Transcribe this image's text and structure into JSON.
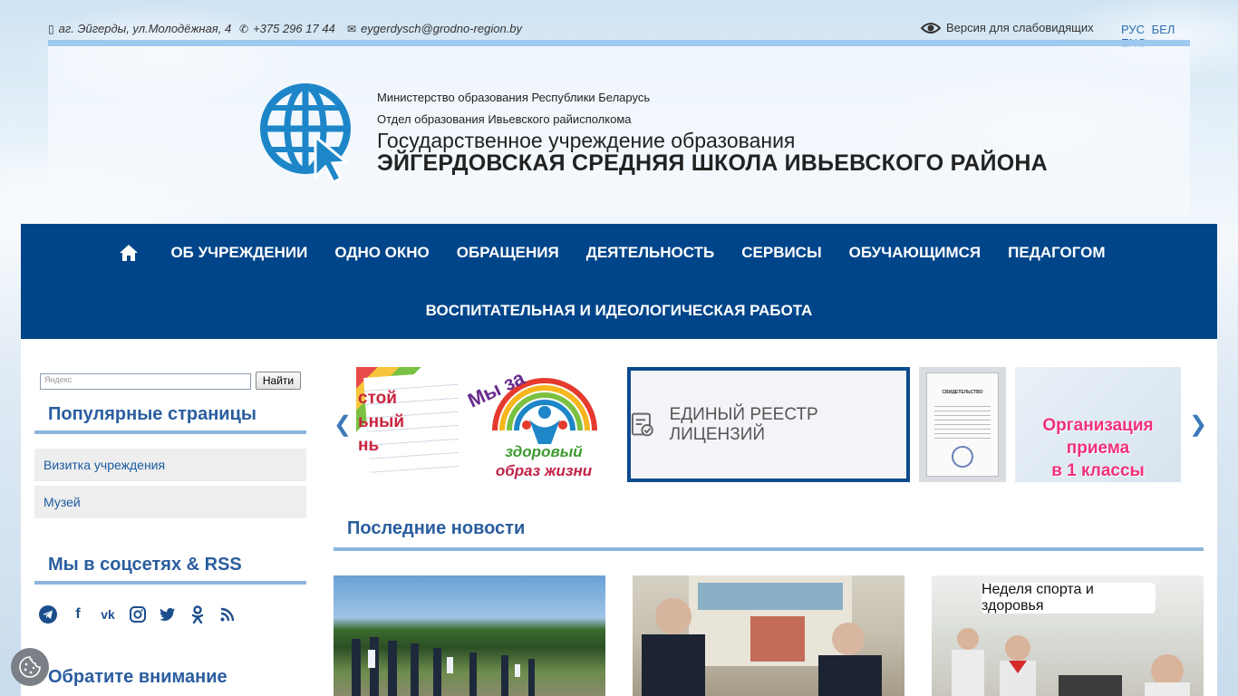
{
  "topbar": {
    "address": "аг. Эйгерды, ул.Молодёжная, 4",
    "phone": "+375 296 17 44",
    "email": "eygerdysch@grodno-region.by",
    "low_vision": "Версия для слабовидящих",
    "languages": [
      "РУС",
      "БЕЛ",
      "ENG"
    ]
  },
  "header": {
    "ministry": "Министерство образования Республики Беларусь",
    "department": "Отдел образования Ивьевского райисполкома",
    "institution_type": "Государственное учреждение образования",
    "school_name": "ЭЙГЕРДОВСКАЯ СРЕДНЯЯ ШКОЛА ИВЬЕВСКОГО РАЙОНА"
  },
  "nav": {
    "items": [
      "ОБ УЧРЕЖДЕНИИ",
      "ОДНО ОКНО",
      "ОБРАЩЕНИЯ",
      "ДЕЯТЕЛЬНОСТЬ",
      "СЕРВИСЫ",
      "ОБУЧАЮЩИМСЯ",
      "ПЕДАГОГОМ"
    ],
    "second_row": "ВОСПИТАТЕЛЬНАЯ И ИДЕОЛОГИЧЕСКАЯ РАБОТА"
  },
  "search": {
    "placeholder": "Яндекс",
    "button": "Найти"
  },
  "sidebar": {
    "popular_title": "Популярные страницы",
    "popular_links": [
      "Визитка учреждения",
      "Музей"
    ],
    "social_title": "Мы в соцсетях & RSS",
    "social_icons": [
      "telegram-icon",
      "facebook-icon",
      "vk-icon",
      "instagram-icon",
      "twitter-icon",
      "odnoklassniki-icon",
      "rss-icon"
    ],
    "notice_title": "Обратите внимание"
  },
  "carousel": {
    "slide1_text": [
      "стой",
      "ьный",
      "нь"
    ],
    "slide2_top": "Мы за",
    "slide2_bottom": [
      "здоровый",
      "образ жизни"
    ],
    "slide3_text": "ЕДИНЫЙ РЕЕСТР ЛИЦЕНЗИЙ",
    "slide4_title": "СВИДЕТЕЛЬСТВО",
    "slide5_text": [
      "Организация",
      "приема",
      "в 1 классы"
    ]
  },
  "news": {
    "title": "Последние новости",
    "item3_caption": "Неделя спорта и здоровья"
  },
  "colors": {
    "nav_bg": "#004589",
    "accent_blue": "#2a5d9f",
    "underline": "#8db5dd",
    "logo_blue": "#1d86c8"
  }
}
